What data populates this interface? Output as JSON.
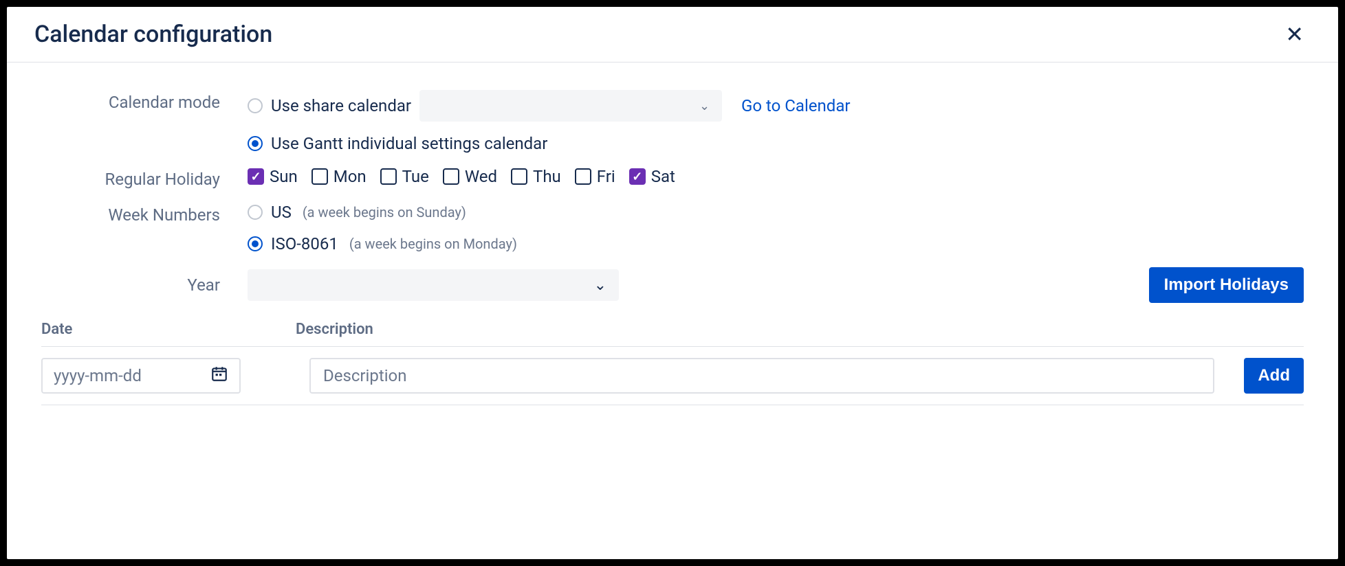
{
  "title": "Calendar configuration",
  "labels": {
    "calendar_mode": "Calendar mode",
    "regular_holiday": "Regular Holiday",
    "week_numbers": "Week Numbers",
    "year": "Year",
    "date_col": "Date",
    "desc_col": "Description"
  },
  "calendar_mode": {
    "share_label": "Use share calendar",
    "share_selected": false,
    "gantt_label": "Use Gantt individual settings calendar",
    "gantt_selected": true,
    "go_link": "Go to Calendar"
  },
  "days": [
    {
      "label": "Sun",
      "checked": true
    },
    {
      "label": "Mon",
      "checked": false
    },
    {
      "label": "Tue",
      "checked": false
    },
    {
      "label": "Wed",
      "checked": false
    },
    {
      "label": "Thu",
      "checked": false
    },
    {
      "label": "Fri",
      "checked": false
    },
    {
      "label": "Sat",
      "checked": true
    }
  ],
  "week_numbers": {
    "us_label": "US",
    "us_hint": "(a week begins on Sunday)",
    "us_selected": false,
    "iso_label": "ISO-8061",
    "iso_hint": "(a week begins on Monday)",
    "iso_selected": true
  },
  "buttons": {
    "import": "Import Holidays",
    "add": "Add"
  },
  "inputs": {
    "date_placeholder": "yyyy-mm-dd",
    "desc_placeholder": "Description"
  }
}
